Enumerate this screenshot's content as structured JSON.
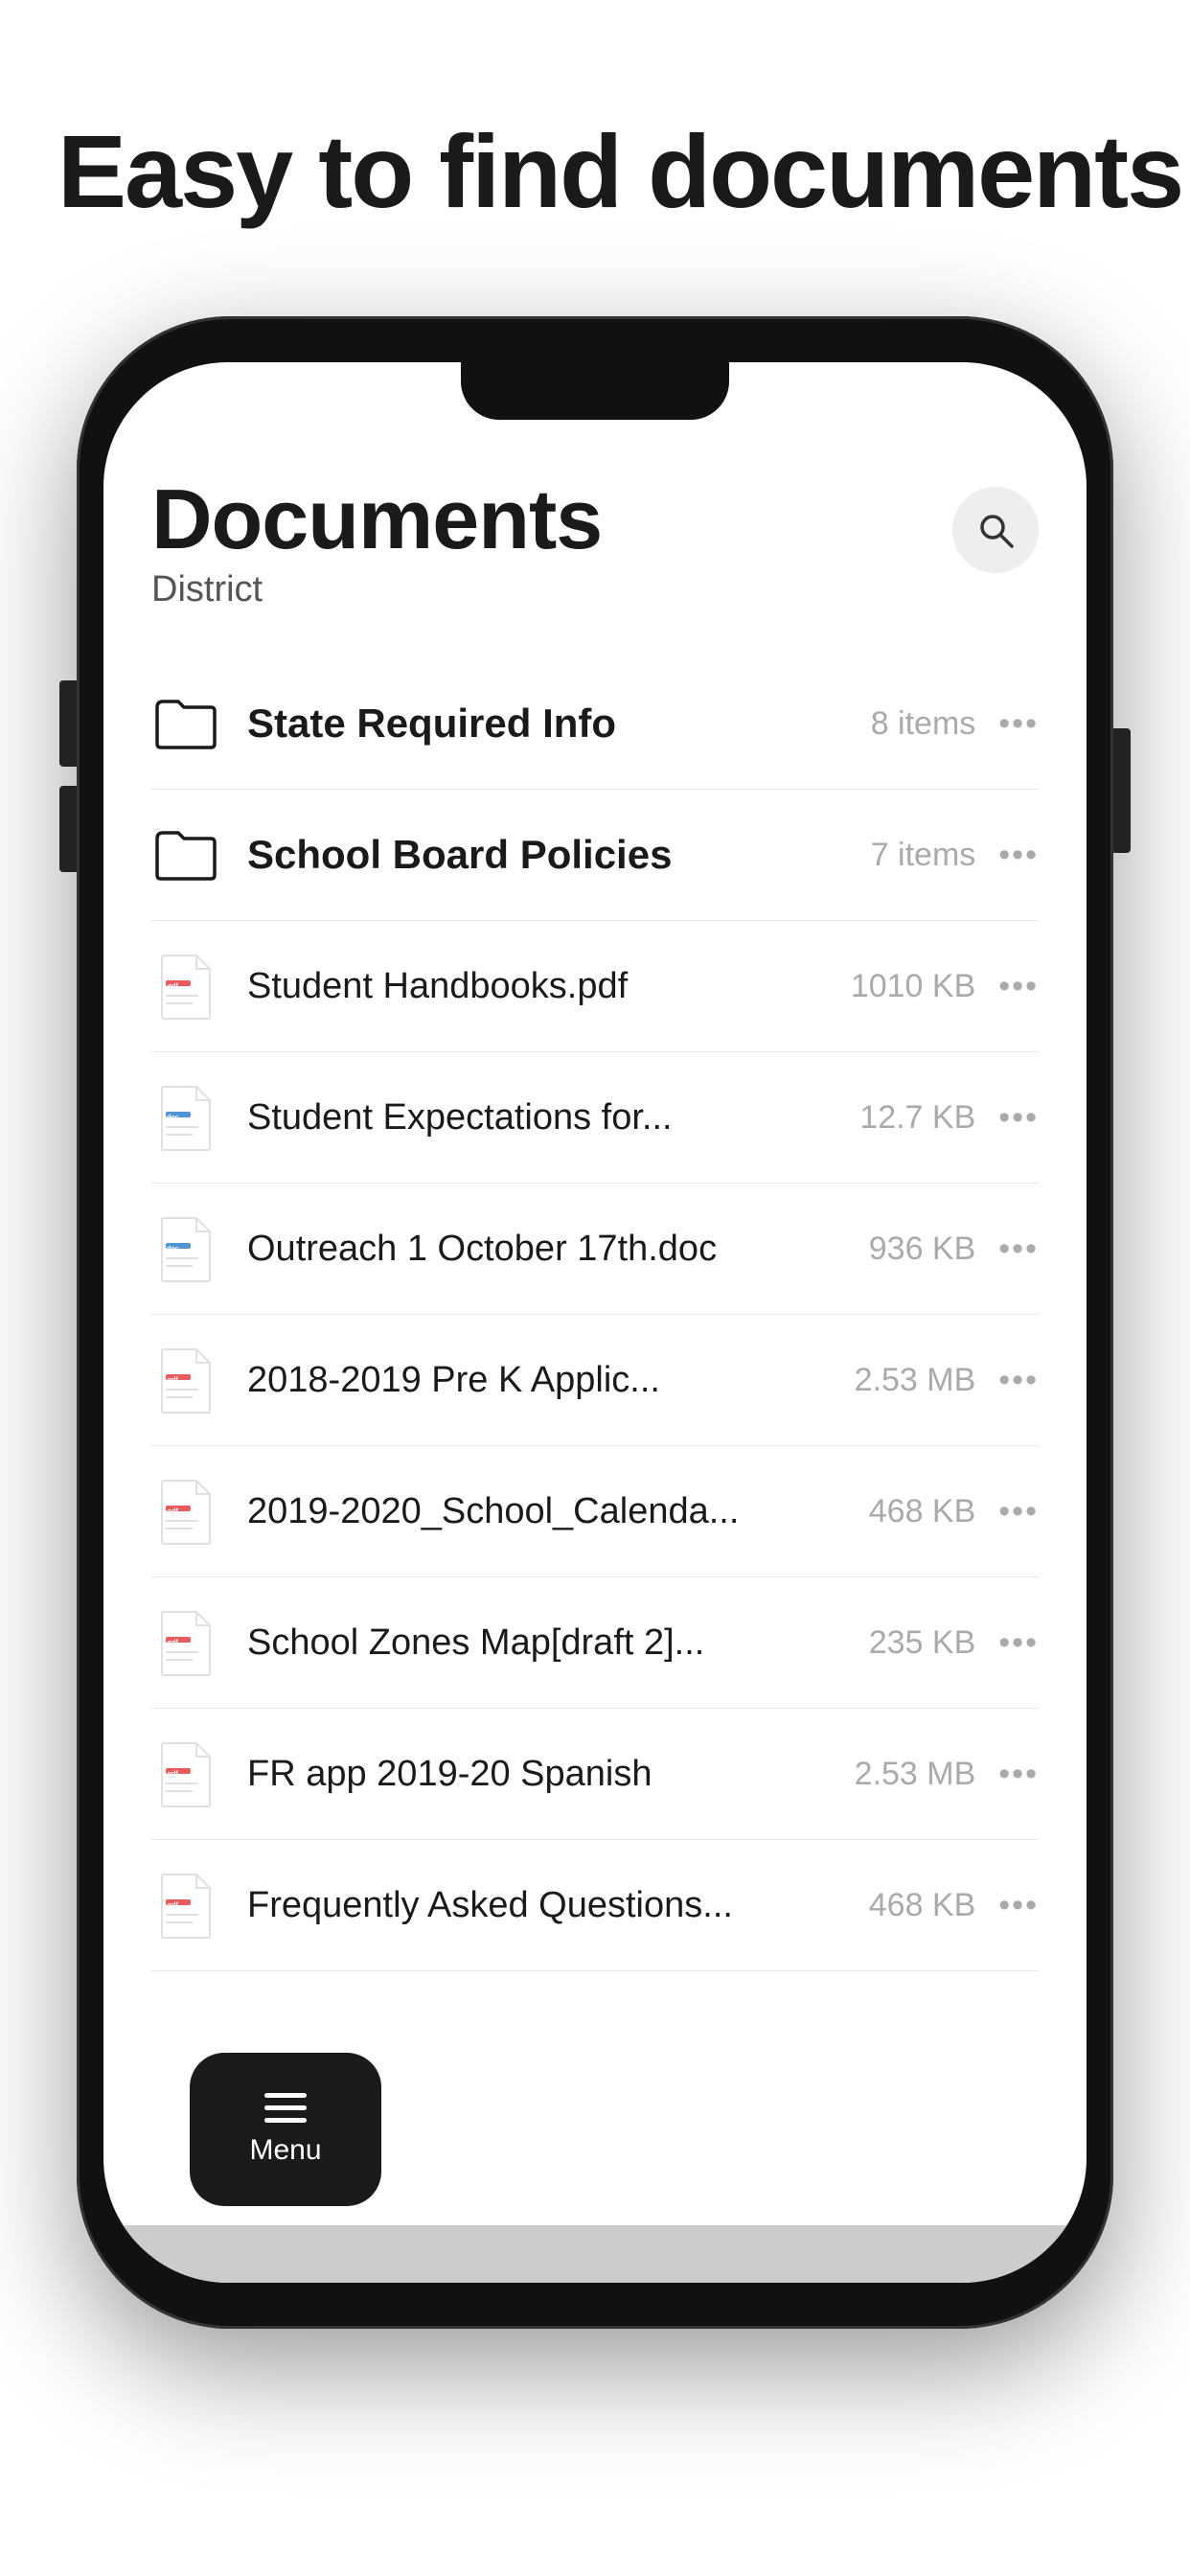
{
  "page": {
    "headline": "Easy to find documents",
    "bg_color": "#ffffff"
  },
  "phone": {
    "screen": {
      "title": "Documents",
      "subtitle": "District",
      "search_aria": "Search"
    },
    "items": [
      {
        "id": "folder-state",
        "type": "folder",
        "name": "State Required Info",
        "name_bold": true,
        "size": "8 items",
        "more": "•••"
      },
      {
        "id": "folder-school-board",
        "type": "folder",
        "name": "School Board Policies",
        "name_bold": true,
        "size": "7 items",
        "more": "•••"
      },
      {
        "id": "file-student-handbooks",
        "type": "pdf",
        "name": "Student Handbooks.pdf",
        "name_bold": false,
        "size": "1010 KB",
        "more": "•••"
      },
      {
        "id": "file-student-expectations",
        "type": "doc",
        "name": "Student Expectations for...",
        "name_bold": false,
        "size": "12.7 KB",
        "more": "•••"
      },
      {
        "id": "file-outreach",
        "type": "doc",
        "name": "Outreach 1 October 17th.doc",
        "name_bold": false,
        "size": "936 KB",
        "more": "•••"
      },
      {
        "id": "file-prek",
        "type": "pdf",
        "name": "2018-2019 Pre K Applic...",
        "name_bold": false,
        "size": "2.53 MB",
        "more": "•••"
      },
      {
        "id": "file-calendar",
        "type": "pdf",
        "name": "2019-2020_School_Calenda...",
        "name_bold": false,
        "size": "468 KB",
        "more": "•••"
      },
      {
        "id": "file-zones",
        "type": "pdf",
        "name": "School Zones Map[draft 2]...",
        "name_bold": false,
        "size": "235 KB",
        "more": "•••"
      },
      {
        "id": "file-fr-app",
        "type": "pdf",
        "name": "FR app 2019-20 Spanish",
        "name_bold": false,
        "size": "2.53 MB",
        "more": "•••"
      },
      {
        "id": "file-faq",
        "type": "pdf",
        "name": "Frequently Asked Questions...",
        "name_bold": false,
        "size": "468 KB",
        "more": "•••"
      }
    ],
    "menu_label": "Menu"
  }
}
